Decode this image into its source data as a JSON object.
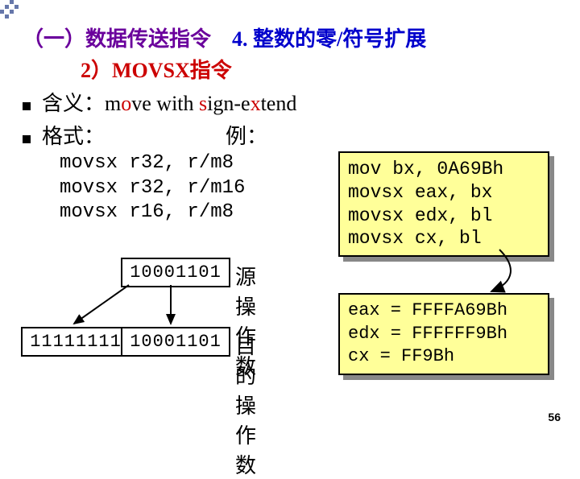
{
  "header": {
    "section_label": "（一）数据传送指令",
    "topic_num": "4.",
    "topic": "整数的零/符号扩展",
    "subtitle": "2）MOVSX指令"
  },
  "bullets": {
    "meaning_label": "含义：",
    "meaning_text_pre": "m",
    "meaning_text_o": "o",
    "meaning_text_mid": "ve with ",
    "meaning_text_s": "s",
    "meaning_text_mid2": "ign-e",
    "meaning_text_x": "x",
    "meaning_text_end": "tend",
    "format_label": "格式：",
    "example_label": "例："
  },
  "syntax": {
    "l1": "movsx r32, r/m8",
    "l2": "movsx r32, r/m16",
    "l3": "movsx r16, r/m8"
  },
  "example": {
    "l1": "mov   bx, 0A69Bh",
    "l2": "movsx eax, bx",
    "l3": "movsx edx, bl",
    "l4": "movsx cx, bl"
  },
  "results": {
    "l1": "eax = FFFFA69Bh",
    "l2": "edx = FFFFFF9Bh",
    "l3": "cx = FF9Bh"
  },
  "diagram": {
    "src_bits": "10001101",
    "dst_hi_bits": "11111111",
    "dst_lo_bits": "10001101",
    "src_label": "源操作数",
    "dst_label": "目的操作数"
  },
  "page": "56"
}
